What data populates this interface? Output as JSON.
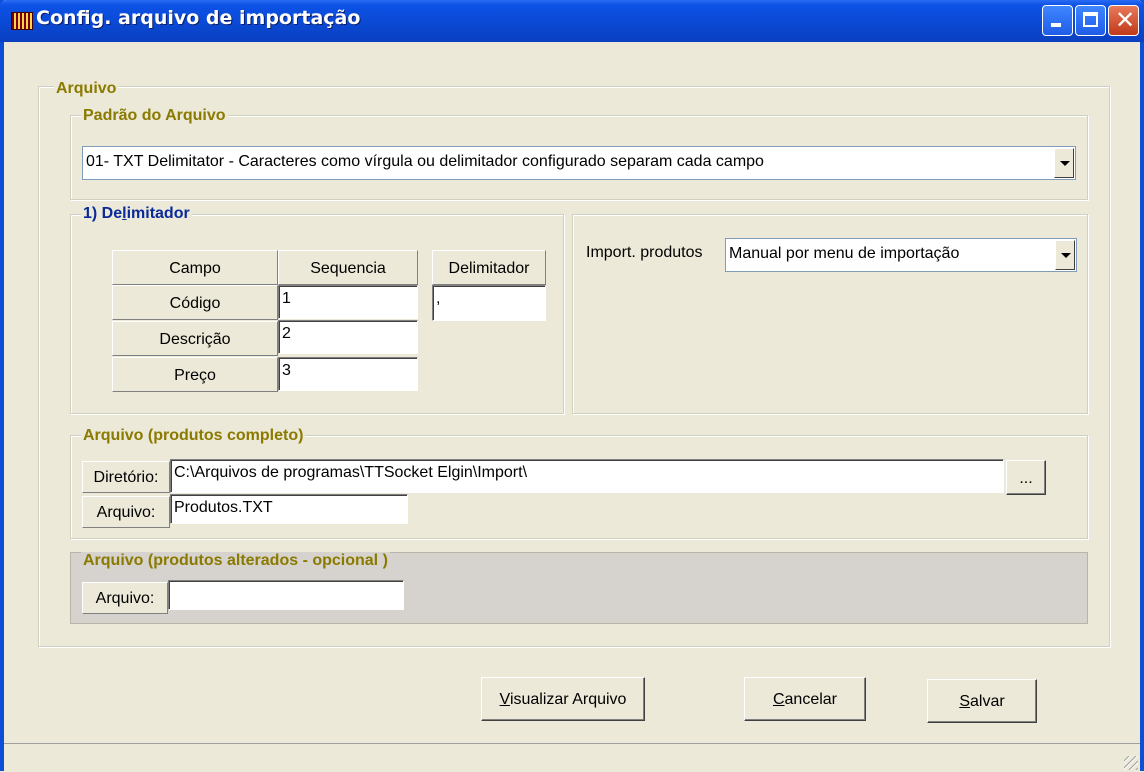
{
  "window": {
    "title": "Config. arquivo de importação"
  },
  "arquivo_group": {
    "label": "Arquivo"
  },
  "padrao": {
    "label": "Padrão do Arquivo",
    "selected": "01- TXT Delimitator  - Caracteres como vírgula ou delimitador configurado separam cada campo"
  },
  "delimitador": {
    "label_prefix": "1) De",
    "label_u": "l",
    "label_suffix": "imitador",
    "headers": {
      "campo": "Campo",
      "sequencia": "Sequencia",
      "delimitador": "Delimitador"
    },
    "rows": [
      {
        "campo": "Código",
        "sequencia": "1"
      },
      {
        "campo": "Descrição",
        "sequencia": "2"
      },
      {
        "campo": "Preço",
        "sequencia": "3"
      }
    ],
    "delimitador_value": ","
  },
  "import_produtos": {
    "label": "Import. produtos",
    "selected": "Manual por menu de importação"
  },
  "completo": {
    "label": "Arquivo (produtos completo)",
    "diretorio_label": "Diretório:",
    "diretorio_value": "C:\\Arquivos de programas\\TTSocket Elgin\\Import\\",
    "browse_label": "...",
    "arquivo_label": "Arquivo:",
    "arquivo_value": "Produtos.TXT"
  },
  "alterados": {
    "label": "Arquivo (produtos alterados - opcional )",
    "arquivo_label": "Arquivo:",
    "arquivo_value": ""
  },
  "buttons": {
    "visualizar_u": "V",
    "visualizar_rest": "isualizar Arquivo",
    "cancelar_u": "C",
    "cancelar_rest": "ancelar",
    "salvar_u": "S",
    "salvar_rest": "alvar"
  }
}
